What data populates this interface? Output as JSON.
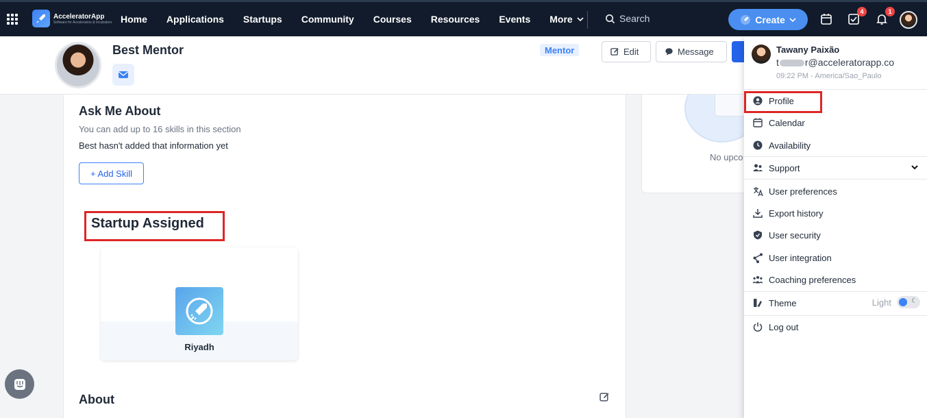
{
  "topbar": {
    "logo_title": "AcceleratorApp",
    "logo_subtitle": "Software for Accelerators & Incubators",
    "nav": [
      "Home",
      "Applications",
      "Startups",
      "Community",
      "Courses",
      "Resources",
      "Events"
    ],
    "more_label": "More",
    "search_placeholder": "Search",
    "create_label": "Create",
    "tasks_badge": "4",
    "notifications_badge": "1"
  },
  "profile": {
    "name": "Best Mentor",
    "role_badge": "Mentor",
    "edit_label": "Edit",
    "message_label": "Message"
  },
  "ask_me_about": {
    "title": "Ask Me About",
    "hint": "You can add up to 16 skills in this section",
    "empty": "Best hasn't added that information yet",
    "add_skill_label": "+ Add Skill"
  },
  "startup_assigned": {
    "title": "Startup Assigned",
    "startups": [
      {
        "name": "Riyadh"
      }
    ]
  },
  "about": {
    "title": "About"
  },
  "right_card": {
    "text": "No upco"
  },
  "dropdown": {
    "user_name": "Tawany Paixão",
    "email_prefix": "t",
    "email_suffix": "r@acceleratorapp.co",
    "time": "09:22 PM - America/Sao_Paulo",
    "items": {
      "profile": "Profile",
      "calendar": "Calendar",
      "availability": "Availability",
      "support": "Support",
      "user_preferences": "User preferences",
      "export_history": "Export history",
      "user_security": "User security",
      "user_integration": "User integration",
      "coaching_preferences": "Coaching preferences",
      "theme": "Theme",
      "theme_value": "Light",
      "logout": "Log out"
    }
  },
  "colors": {
    "topbar_bg": "#111b2b",
    "accent": "#4a8ef0",
    "highlight": "#dc2626",
    "badge": "#ef4444"
  }
}
